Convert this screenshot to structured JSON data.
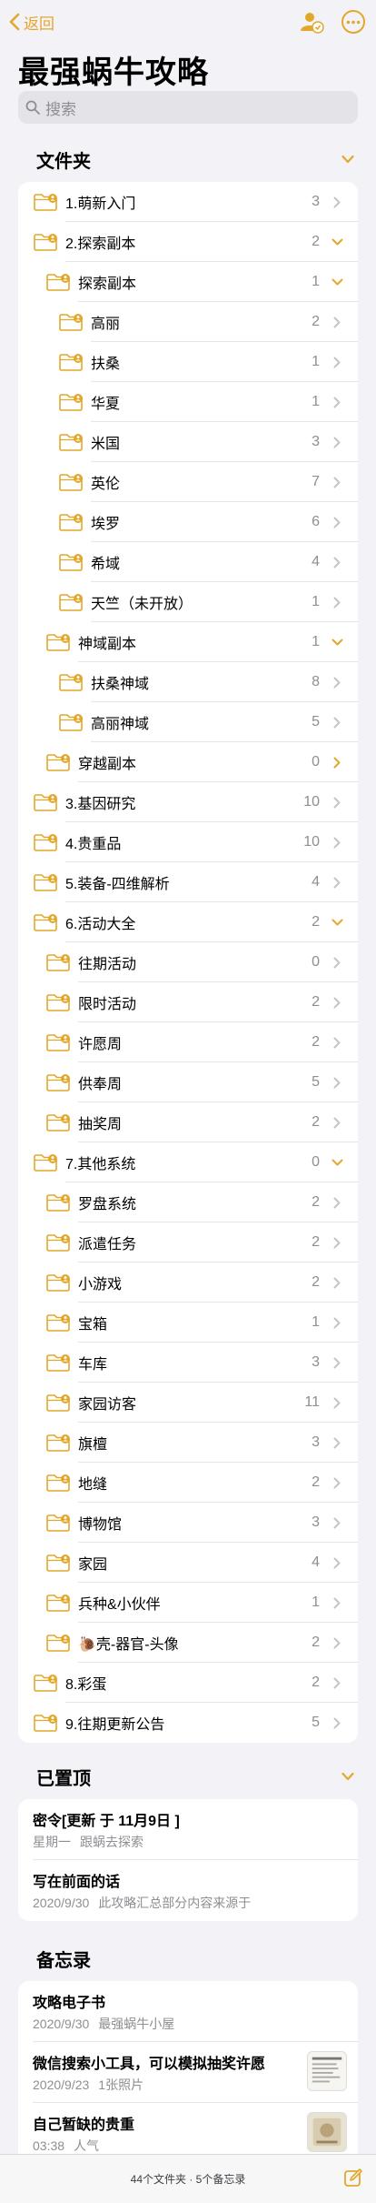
{
  "nav": {
    "back_label": "返回"
  },
  "title": "最强蜗牛攻略",
  "search": {
    "placeholder": "搜索"
  },
  "folders": {
    "header": "文件夹",
    "items": [
      {
        "name": "1.萌新入门",
        "count": "3",
        "level": 0,
        "expanded": false
      },
      {
        "name": "2.探索副本",
        "count": "2",
        "level": 0,
        "expanded": true
      },
      {
        "name": "探索副本",
        "count": "1",
        "level": 1,
        "expanded": true
      },
      {
        "name": "高丽",
        "count": "2",
        "level": 2,
        "expanded": false
      },
      {
        "name": "扶桑",
        "count": "1",
        "level": 2,
        "expanded": false
      },
      {
        "name": "华夏",
        "count": "1",
        "level": 2,
        "expanded": false
      },
      {
        "name": "米国",
        "count": "3",
        "level": 2,
        "expanded": false
      },
      {
        "name": "英伦",
        "count": "7",
        "level": 2,
        "expanded": false
      },
      {
        "name": "埃罗",
        "count": "6",
        "level": 2,
        "expanded": false
      },
      {
        "name": "希域",
        "count": "4",
        "level": 2,
        "expanded": false
      },
      {
        "name": "天竺（未开放）",
        "count": "1",
        "level": 2,
        "expanded": false
      },
      {
        "name": "神域副本",
        "count": "1",
        "level": 1,
        "expanded": true
      },
      {
        "name": "扶桑神域",
        "count": "8",
        "level": 2,
        "expanded": false
      },
      {
        "name": "高丽神域",
        "count": "5",
        "level": 2,
        "expanded": false
      },
      {
        "name": "穿越副本",
        "count": "0",
        "level": 1,
        "expanded": false,
        "accent": true
      },
      {
        "name": "3.基因研究",
        "count": "10",
        "level": 0,
        "expanded": false
      },
      {
        "name": "4.贵重品",
        "count": "10",
        "level": 0,
        "expanded": false
      },
      {
        "name": "5.装备-四维解析",
        "count": "4",
        "level": 0,
        "expanded": false
      },
      {
        "name": "6.活动大全",
        "count": "2",
        "level": 0,
        "expanded": true
      },
      {
        "name": "往期活动",
        "count": "0",
        "level": 1,
        "expanded": false
      },
      {
        "name": "限时活动",
        "count": "2",
        "level": 1,
        "expanded": false
      },
      {
        "name": "许愿周",
        "count": "2",
        "level": 1,
        "expanded": false
      },
      {
        "name": "供奉周",
        "count": "5",
        "level": 1,
        "expanded": false
      },
      {
        "name": "抽奖周",
        "count": "2",
        "level": 1,
        "expanded": false
      },
      {
        "name": "7.其他系统",
        "count": "0",
        "level": 0,
        "expanded": true
      },
      {
        "name": "罗盘系统",
        "count": "2",
        "level": 1,
        "expanded": false
      },
      {
        "name": "派遣任务",
        "count": "2",
        "level": 1,
        "expanded": false
      },
      {
        "name": "小游戏",
        "count": "2",
        "level": 1,
        "expanded": false
      },
      {
        "name": "宝箱",
        "count": "1",
        "level": 1,
        "expanded": false
      },
      {
        "name": "车库",
        "count": "3",
        "level": 1,
        "expanded": false
      },
      {
        "name": "家园访客",
        "count": "11",
        "level": 1,
        "expanded": false
      },
      {
        "name": "旗檀",
        "count": "3",
        "level": 1,
        "expanded": false
      },
      {
        "name": "地缝",
        "count": "2",
        "level": 1,
        "expanded": false
      },
      {
        "name": "博物馆",
        "count": "3",
        "level": 1,
        "expanded": false
      },
      {
        "name": "家园",
        "count": "4",
        "level": 1,
        "expanded": false
      },
      {
        "name": "兵种&小伙伴",
        "count": "1",
        "level": 1,
        "expanded": false
      },
      {
        "name": "🐌壳-器官-头像",
        "count": "2",
        "level": 1,
        "expanded": false
      },
      {
        "name": "8.彩蛋",
        "count": "2",
        "level": 0,
        "expanded": false
      },
      {
        "name": "9.往期更新公告",
        "count": "5",
        "level": 0,
        "expanded": false
      }
    ]
  },
  "pinned": {
    "header": "已置顶",
    "notes": [
      {
        "title": "密令[更新 于 11月9日 ]",
        "date": "星期一",
        "preview": "跟蜗去探索"
      },
      {
        "title": "写在前面的话",
        "date": "2020/9/30",
        "preview": "此攻略汇总部分内容来源于"
      }
    ]
  },
  "memos": {
    "header": "备忘录",
    "notes": [
      {
        "title": "攻略电子书",
        "date": "2020/9/30",
        "preview": "最强蜗牛小屋",
        "thumb": false
      },
      {
        "title": "微信搜索小工具，可以模拟抽奖许愿",
        "date": "2020/9/23",
        "preview": "1张照片",
        "thumb": true
      },
      {
        "title": "自己暂缺的贵重",
        "date": "03:38",
        "preview": "人气",
        "thumb": true
      }
    ]
  },
  "footer": {
    "summary": "44个文件夹 · 5个备忘录"
  },
  "colors": {
    "accent": "#e3a82b",
    "background": "#f2f2f7",
    "card": "#ffffff",
    "secondary_text": "#8e8e93"
  }
}
